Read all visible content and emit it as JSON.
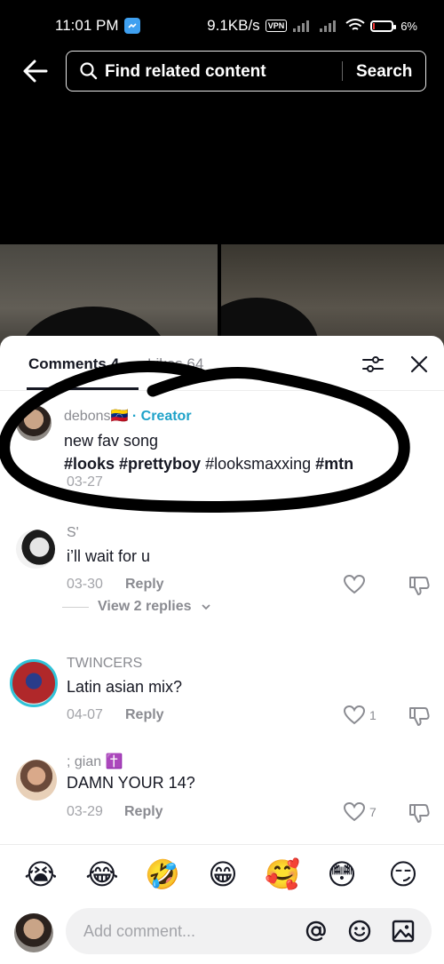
{
  "status_bar": {
    "time": "11:01 PM",
    "network_speed": "9.1KB/s",
    "vpn_label": "VPN",
    "battery": "6%"
  },
  "search": {
    "placeholder": "Find related content",
    "button_label": "Search"
  },
  "comments_sheet": {
    "tab_comments": "Comments 4",
    "tab_likes": "Likes 64",
    "comments": [
      {
        "username": "debons🇻🇪",
        "creator_label": " · Creator",
        "text_parts": [
          "#looks",
          " #prettyboy",
          " #looksmaxxing",
          " #mtn"
        ],
        "first_line": "new fav song",
        "date": "03-27"
      },
      {
        "username": "S'",
        "text": "i’ll wait for u",
        "date": "03-30",
        "reply_label": "Reply",
        "view_replies": "View 2 replies"
      },
      {
        "username": "TWINCERS",
        "text": "Latin asian mix?",
        "date": "04-07",
        "reply_label": "Reply",
        "likes": "1"
      },
      {
        "username": "; gian ✝️",
        "text": "DAMN YOUR 14?",
        "date": "03-29",
        "reply_label": "Reply",
        "likes": "7"
      }
    ]
  },
  "emojis": [
    "😭",
    "😂",
    "🤣",
    "😁",
    "🥰",
    "😳",
    "😏"
  ],
  "input": {
    "placeholder": "Add comment..."
  },
  "colors": {
    "creator_accent": "#1fa2c9",
    "sheet_bg": "#ffffff",
    "page_bg": "#000000"
  }
}
